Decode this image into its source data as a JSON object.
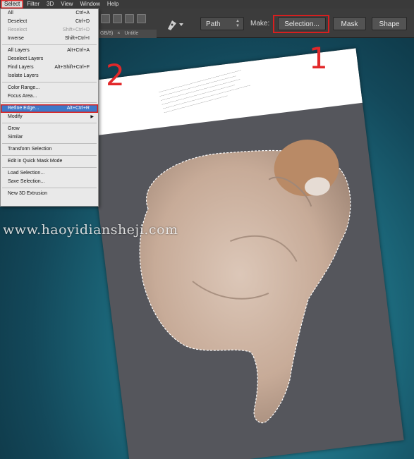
{
  "menubar": {
    "items": [
      "Select",
      "Filter",
      "3D",
      "View",
      "Window",
      "Help"
    ]
  },
  "options_bar": {
    "doc_tab": [
      "GB/8)",
      "×",
      "Untitle"
    ],
    "path_mode": "Path",
    "make_label": "Make:",
    "selection_button": "Selection...",
    "mask_button": "Mask",
    "shape_button": "Shape"
  },
  "dropdown": {
    "groups": [
      [
        {
          "label": "All",
          "shortcut": "Ctrl+A",
          "enabled": true
        },
        {
          "label": "Deselect",
          "shortcut": "Ctrl+D",
          "enabled": true
        },
        {
          "label": "Reselect",
          "shortcut": "Shift+Ctrl+D",
          "enabled": false
        },
        {
          "label": "Inverse",
          "shortcut": "Shift+Ctrl+I",
          "enabled": true
        }
      ],
      [
        {
          "label": "All Layers",
          "shortcut": "Alt+Ctrl+A",
          "enabled": true
        },
        {
          "label": "Deselect Layers",
          "shortcut": "",
          "enabled": true
        },
        {
          "label": "Find Layers",
          "shortcut": "Alt+Shift+Ctrl+F",
          "enabled": true
        },
        {
          "label": "Isolate Layers",
          "shortcut": "",
          "enabled": true
        }
      ],
      [
        {
          "label": "Color Range...",
          "shortcut": "",
          "enabled": true
        },
        {
          "label": "Focus Area...",
          "shortcut": "",
          "enabled": true
        }
      ],
      [
        {
          "label": "Refine Edge...",
          "shortcut": "Alt+Ctrl+R",
          "enabled": true,
          "highlighted": true
        },
        {
          "label": "Modify",
          "shortcut": "",
          "enabled": true,
          "submenu": true
        }
      ],
      [
        {
          "label": "Grow",
          "shortcut": "",
          "enabled": true
        },
        {
          "label": "Similar",
          "shortcut": "",
          "enabled": true
        }
      ],
      [
        {
          "label": "Transform Selection",
          "shortcut": "",
          "enabled": true
        }
      ],
      [
        {
          "label": "Edit in Quick Mask Mode",
          "shortcut": "",
          "enabled": true
        }
      ],
      [
        {
          "label": "Load Selection...",
          "shortcut": "",
          "enabled": true
        },
        {
          "label": "Save Selection...",
          "shortcut": "",
          "enabled": true
        }
      ],
      [
        {
          "label": "New 3D Extrusion",
          "shortcut": "",
          "enabled": true
        }
      ]
    ]
  },
  "annotations": {
    "step1": "1",
    "step2": "2"
  },
  "watermark": "www.haoyidiansheji.com",
  "colors": {
    "annotation_red": "#d71f1f",
    "menu_highlight": "#3d78c9",
    "workspace_teal": "#1f7386"
  },
  "icons": {
    "pen_tool": "pen-tool-icon",
    "submenu": "chevron-right-icon"
  }
}
